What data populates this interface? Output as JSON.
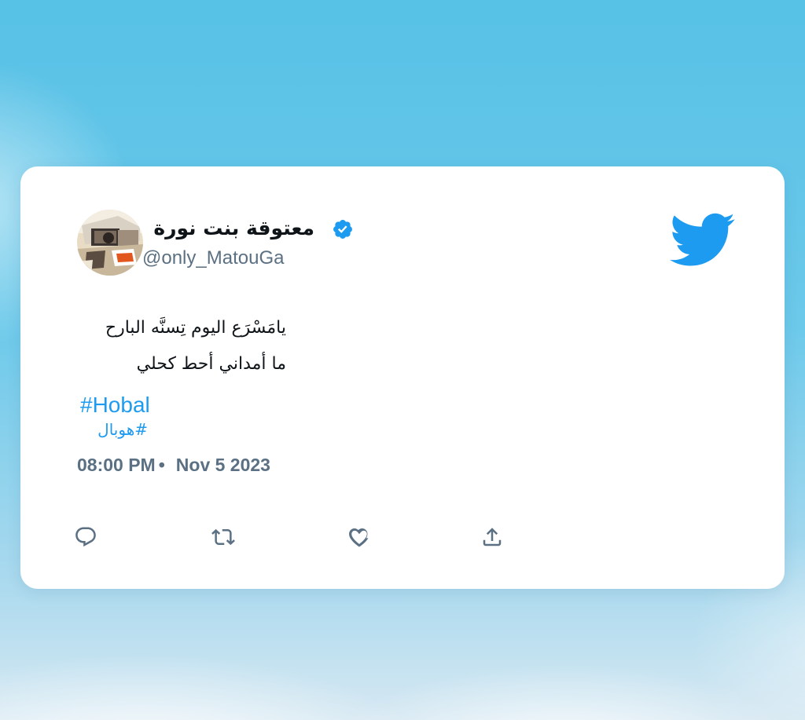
{
  "tweet": {
    "display_name": "معتوقة بنت نورة",
    "handle": "@only_MatouGa",
    "text_lines": [
      "يامَسْرَع اليوم تِسنَّه البارح",
      "ما أمداني أحط كحلي"
    ],
    "hashtags": [
      "#Hobal",
      "#هوبال"
    ],
    "time": "08:00 PM",
    "separator": "•",
    "date": "Nov 5 2023"
  },
  "icons": {
    "verified": "verified-badge-icon",
    "brand": "twitter-bird-icon",
    "reply": "reply-icon",
    "retweet": "retweet-icon",
    "like": "heart-icon",
    "share": "share-icon"
  },
  "colors": {
    "accent": "#1d9bf0",
    "text": "#0f1419",
    "muted": "#5b7083",
    "card": "#ffffff",
    "sky": "#57c1e6"
  }
}
